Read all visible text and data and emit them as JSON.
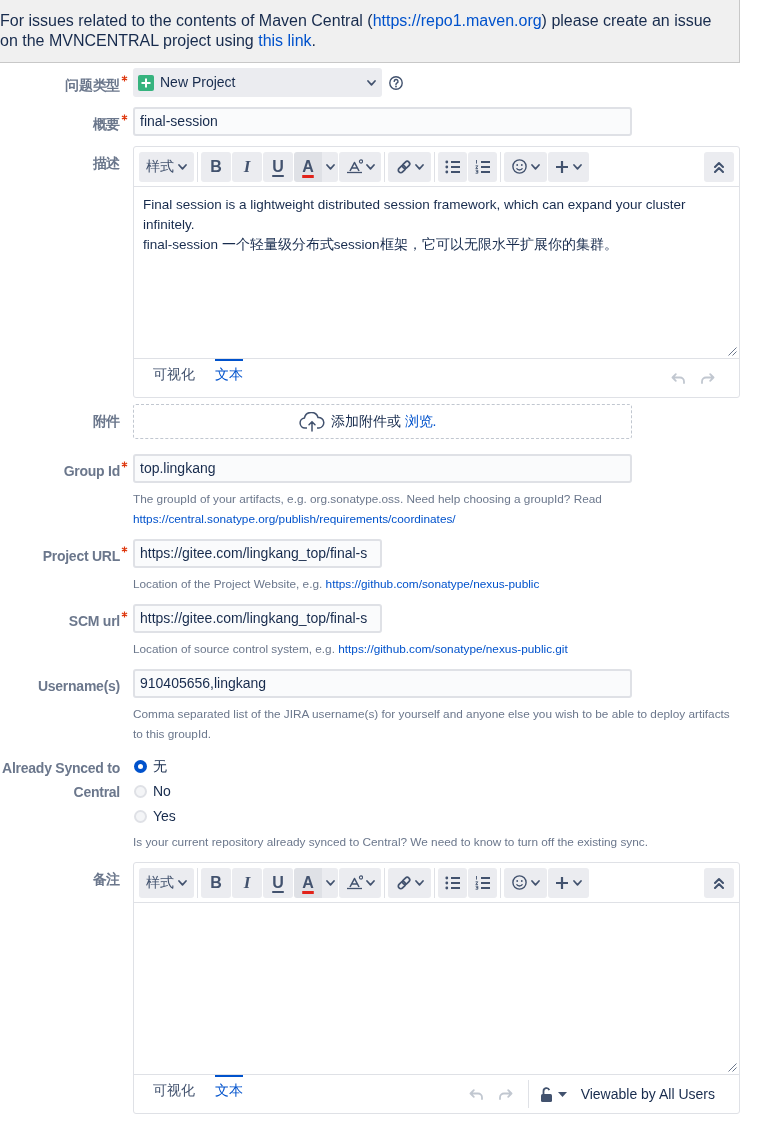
{
  "notice": {
    "parts": [
      {
        "kind": "text",
        "text": "For issues related to the contents of Maven Central ("
      },
      {
        "kind": "link",
        "text": "https://repo1.maven.org"
      },
      {
        "kind": "text",
        "text": ") please create an issue on the MVNCENTRAL project using "
      },
      {
        "kind": "link",
        "text": "this link"
      },
      {
        "kind": "text",
        "text": "."
      }
    ]
  },
  "fields": [
    {
      "kind": "select",
      "label": "问题类型",
      "required": true,
      "value": "New Project"
    },
    {
      "kind": "text",
      "label": "概要",
      "required": true,
      "value": "final-session"
    },
    {
      "kind": "editor",
      "label": "描述",
      "required": false,
      "toolbar": [
        {
          "kind": "style",
          "label": "样式"
        },
        {
          "kind": "bold",
          "glyph": "B"
        },
        {
          "kind": "italic",
          "glyph": "I"
        },
        {
          "kind": "underline",
          "glyph": "U"
        },
        {
          "kind": "color",
          "glyph": "A"
        },
        {
          "kind": "clear"
        },
        {
          "kind": "link"
        },
        {
          "kind": "bullets"
        },
        {
          "kind": "numbers"
        },
        {
          "kind": "emoji"
        },
        {
          "kind": "insert"
        },
        {
          "kind": "collapse"
        }
      ],
      "content": [
        "Final session is a lightweight distributed session framework, which can expand your cluster infinitely.",
        "final-session 一个轻量级分布式session框架，它可以无限水平扩展你的集群。"
      ],
      "tabs": [
        {
          "label": "可视化",
          "selected": false
        },
        {
          "label": "文本",
          "selected": true
        }
      ],
      "actions": [
        {
          "kind": "undo",
          "disabled": true
        },
        {
          "kind": "redo",
          "disabled": true
        }
      ]
    },
    {
      "kind": "attachment",
      "label": "附件",
      "required": false,
      "text": "添加附件或",
      "link": "浏览."
    },
    {
      "kind": "text",
      "label": "Group Id",
      "required": true,
      "value": "top.lingkang",
      "help": [
        {
          "kind": "text",
          "text": "The groupId of your artifacts, e.g. org.sonatype.oss. Need help choosing a groupId? Read "
        },
        {
          "kind": "link",
          "text": "https://central.sonatype.org/publish/requirements/coordinates/"
        }
      ]
    },
    {
      "kind": "url",
      "label": "Project URL",
      "required": true,
      "value": "https://gitee.com/lingkang_top/final-s",
      "help": [
        {
          "kind": "text",
          "text": "Location of the Project Website, e.g. "
        },
        {
          "kind": "link",
          "text": "https://github.com/sonatype/nexus-public"
        }
      ]
    },
    {
      "kind": "url",
      "label": "SCM url",
      "required": true,
      "value": "https://gitee.com/lingkang_top/final-s",
      "help": [
        {
          "kind": "text",
          "text": "Location of source control system, e.g. "
        },
        {
          "kind": "link",
          "text": "https://github.com/sonatype/nexus-public.git"
        }
      ]
    },
    {
      "kind": "text",
      "label": "Username(s)",
      "required": false,
      "value": "910405656,lingkang",
      "help": [
        {
          "kind": "text",
          "text": "Comma separated list of the JIRA username(s) for yourself and anyone else you wish to be able to deploy artifacts to this groupId."
        }
      ]
    },
    {
      "kind": "radio",
      "label": "Already Synced to Central",
      "required": false,
      "options": [
        {
          "label": "无",
          "selected": true
        },
        {
          "label": "No",
          "selected": false
        },
        {
          "label": "Yes",
          "selected": false
        }
      ],
      "help": [
        {
          "kind": "text",
          "text": "Is your current repository already synced to Central? We need to know to turn off the existing sync."
        }
      ]
    },
    {
      "kind": "editor",
      "label": "备注",
      "required": false,
      "toolbar": [
        {
          "kind": "style",
          "label": "样式"
        },
        {
          "kind": "bold",
          "glyph": "B"
        },
        {
          "kind": "italic",
          "glyph": "I"
        },
        {
          "kind": "underline",
          "glyph": "U"
        },
        {
          "kind": "color",
          "glyph": "A"
        },
        {
          "kind": "clear"
        },
        {
          "kind": "link"
        },
        {
          "kind": "bullets"
        },
        {
          "kind": "numbers"
        },
        {
          "kind": "emoji"
        },
        {
          "kind": "insert"
        },
        {
          "kind": "collapse"
        }
      ],
      "tabs": [
        {
          "label": "可视化",
          "selected": false
        },
        {
          "label": "文本",
          "selected": true
        }
      ],
      "actions": [
        {
          "kind": "undo",
          "disabled": true
        },
        {
          "kind": "redo",
          "disabled": true
        }
      ],
      "security": {
        "label": "Viewable by All Users"
      }
    }
  ]
}
